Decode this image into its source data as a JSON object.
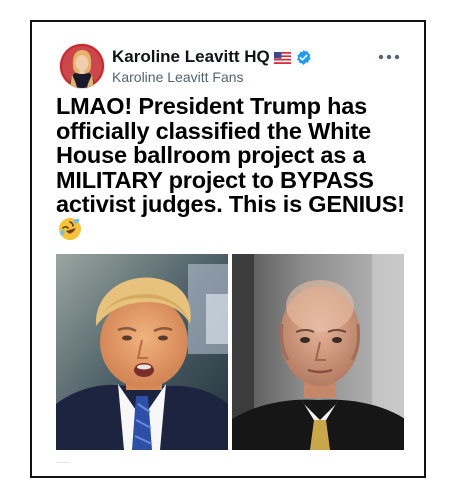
{
  "tweet": {
    "display_name": "Karoline Leavitt HQ",
    "handle": "Karoline Leavitt Fans",
    "text": "LMAO! President Trump has officially classified the White House ballroom project as a MILITARY project to BYPASS activist judges. This is GENIUS!",
    "emoji": "rolling-on-floor-laughing-emoji",
    "flag": "us-flag-icon",
    "verified": true,
    "more_icon": "more-horizontal-icon"
  },
  "media": {
    "count": 2,
    "photos": [
      {
        "subject": "Donald Trump portrait"
      },
      {
        "subject": "bald man in judicial robe portrait"
      }
    ]
  },
  "colors": {
    "verified_blue": "#1d9bf0",
    "text": "#0f1419",
    "secondary_text": "#536471",
    "frame": "#111111"
  }
}
